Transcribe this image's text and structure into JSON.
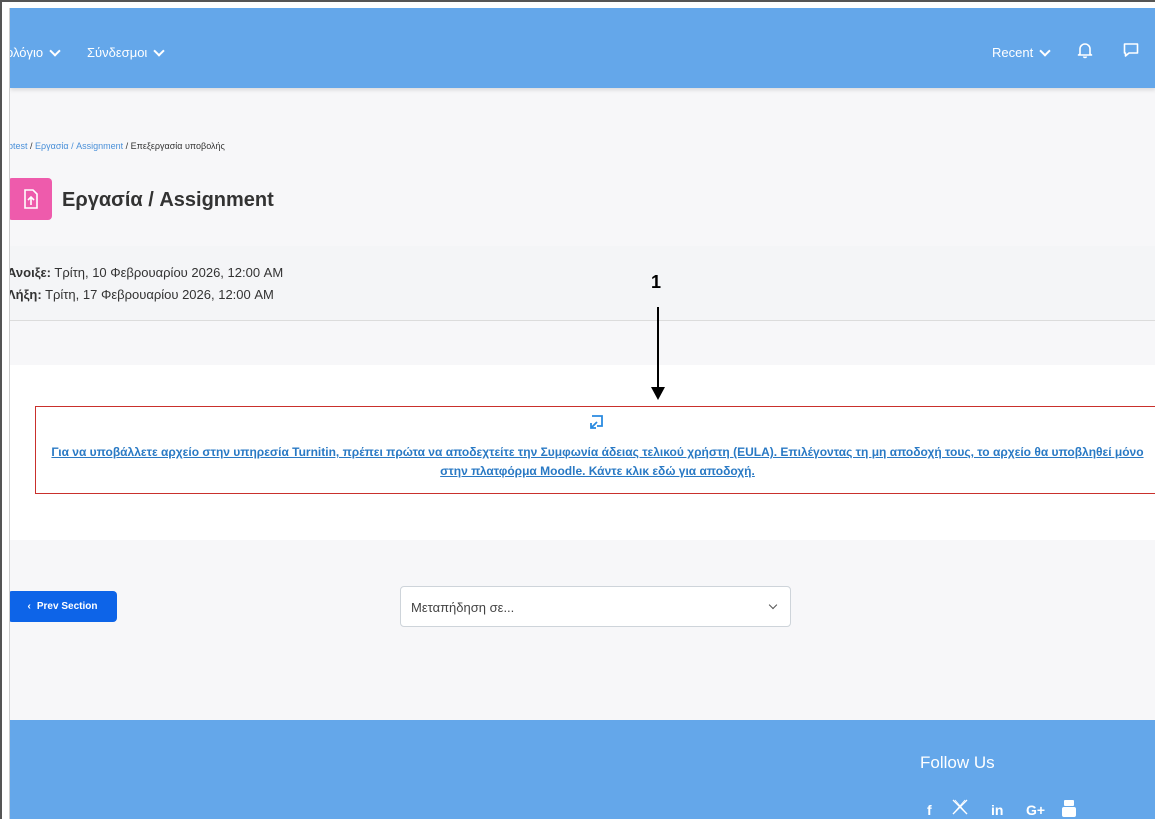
{
  "navbar": {
    "items": [
      {
        "label": "ολόγιο"
      },
      {
        "label": "Σύνδεσμοι"
      }
    ],
    "recent_label": "Recent"
  },
  "breadcrumb": {
    "first": "btest",
    "sep1": " / ",
    "second": "Εργασία / Assignment",
    "sep2": " / ",
    "current": "Επεξεργασία υποβολής"
  },
  "page_title": "Εργασία / Assignment",
  "dates": {
    "opened_label": "Άνοιξε:",
    "opened_value": "Τρίτη, 10 Φεβρουαρίου 2026, 12:00 AM",
    "due_label": "Λήξη:",
    "due_value": "Τρίτη, 17 Φεβρουαρίου 2026, 12:00 AM"
  },
  "eula": {
    "text": "Για να υποβάλλετε αρχείο στην υπηρεσία Turnitin, πρέπει πρώτα να αποδεχτείτε την Συμφωνία άδειας τελικού χρήστη (EULA). Επιλέγοντας τη μη αποδοχή τους, το αρχείο θα υποβληθεί μόνο στην πλατφόρμα Moodle. Κάντε κλικ εδώ για αποδοχή."
  },
  "prev_section_label": "Prev Section",
  "jump_to": {
    "placeholder": "Μεταπήδηση σε..."
  },
  "footer": {
    "follow_label": "Follow Us",
    "social": [
      "f",
      "in",
      "G+"
    ]
  },
  "annotation": {
    "number": "1"
  },
  "colors": {
    "navbar": "#64a7ea",
    "title_icon": "#ee5bac",
    "eula_border": "#c9302c",
    "link": "#2979c4",
    "button": "#0d64e8"
  }
}
